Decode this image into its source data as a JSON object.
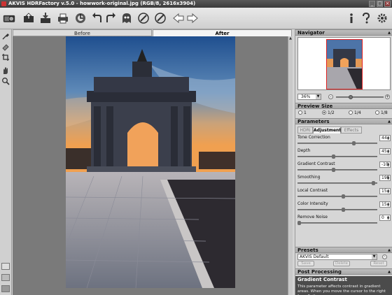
{
  "window": {
    "title": "AKVIS HDRFactory v.5.0 - howwork-original.jpg (RGB/8, 2616x3904)",
    "min_glyph": "_",
    "max_glyph": "□",
    "close_glyph": "×"
  },
  "toolbar": {
    "buttons": [
      "hdr-factory-icon",
      "open-icon",
      "save-icon",
      "print-icon",
      "batch-icon",
      "undo-icon",
      "redo-icon",
      "ghost-icon",
      "plugin-icon",
      "brush-icon",
      "back-icon",
      "forward-icon",
      "info-icon",
      "help-icon",
      "settings-icon"
    ]
  },
  "view_tabs": {
    "before": "Before",
    "after": "After"
  },
  "navigator": {
    "header": "Navigator",
    "zoom": "36%",
    "zoom_level": 0.36
  },
  "preview_size": {
    "header": "Preview Size",
    "options": [
      "1",
      "1/2",
      "1/4",
      "1/8"
    ],
    "selected": "1/2"
  },
  "parameters": {
    "header": "Parameters",
    "tabs": [
      "HDRI",
      "Adjustment",
      "Effects"
    ],
    "active_tab": "Adjustment",
    "items": [
      {
        "label": "Tone Correction",
        "value": "44",
        "min": -100,
        "max": 100,
        "level": 44
      },
      {
        "label": "Depth",
        "value": "45",
        "min": 0,
        "max": 100,
        "level": 45
      },
      {
        "label": "Gradient Contrast",
        "value": "-10",
        "min": -100,
        "max": 100,
        "level": -10
      },
      {
        "label": "Smoothing",
        "value": "195",
        "min": 0,
        "max": 200,
        "level": 195
      },
      {
        "label": "Local Contrast",
        "value": "15",
        "min": -100,
        "max": 100,
        "level": 15
      },
      {
        "label": "Color Intensity",
        "value": "15",
        "min": -100,
        "max": 100,
        "level": 15
      },
      {
        "label": "Remove Noise",
        "value": "0",
        "min": 0,
        "max": 100,
        "level": 0
      }
    ]
  },
  "presets": {
    "header": "Presets",
    "selected": "AKVIS Default",
    "buttons": {
      "save": "Save",
      "delete": "Delete",
      "reset": "Reset"
    }
  },
  "post_processing": {
    "header": "Post Processing"
  },
  "hint": {
    "title": "Gradient Contrast",
    "text": "This parameter affects contrast in gradient areas. When you move the cursor to the right from 0, the"
  }
}
